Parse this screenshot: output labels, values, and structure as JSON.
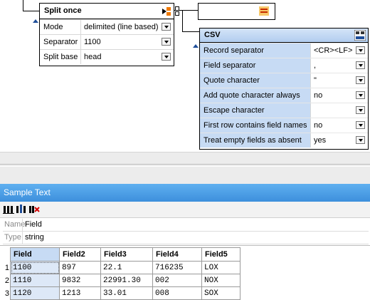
{
  "split_node": {
    "title": "Split once",
    "rows": [
      {
        "label": "Mode",
        "value": "delimited (line based)"
      },
      {
        "label": "Separator",
        "value": "1100"
      },
      {
        "label": "Split base",
        "value": "head"
      }
    ]
  },
  "csv_node": {
    "title": "CSV",
    "rows": [
      {
        "label": "Record separator",
        "value": "<CR><LF>"
      },
      {
        "label": "Field separator",
        "value": ","
      },
      {
        "label": "Quote character",
        "value": "\""
      },
      {
        "label": "Add quote character always",
        "value": "no"
      },
      {
        "label": "Escape character",
        "value": ""
      },
      {
        "label": "First row contains field names",
        "value": "no"
      },
      {
        "label": "Treat empty fields as absent",
        "value": "yes"
      }
    ]
  },
  "panel": {
    "title": "Sample Text"
  },
  "meta": {
    "name_label": "Name",
    "name_value": "Field",
    "type_label": "Type",
    "type_value": "string"
  },
  "grid": {
    "headers": [
      "Field",
      "Field2",
      "Field3",
      "Field4",
      "Field5"
    ],
    "rows": [
      {
        "n": "1",
        "cells": [
          "1100",
          "897",
          "22.1",
          "716235",
          "LOX"
        ]
      },
      {
        "n": "2",
        "cells": [
          "1110",
          "9832",
          "22991.30",
          "002",
          "NOX"
        ]
      },
      {
        "n": "3",
        "cells": [
          "1120",
          "1213",
          "33.01",
          "008",
          "SOX"
        ]
      }
    ]
  },
  "colors": {
    "accent": "#3d8fdc",
    "selection": "#c7dbf4",
    "icon_orange": "#f07a00"
  }
}
